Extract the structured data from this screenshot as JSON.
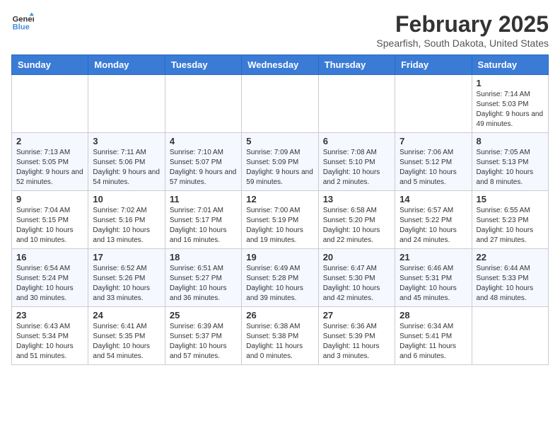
{
  "app": {
    "name": "GeneralBlue",
    "logo_text_part1": "General",
    "logo_text_part2": "Blue"
  },
  "header": {
    "month_year": "February 2025",
    "location": "Spearfish, South Dakota, United States"
  },
  "days_of_week": [
    "Sunday",
    "Monday",
    "Tuesday",
    "Wednesday",
    "Thursday",
    "Friday",
    "Saturday"
  ],
  "weeks": [
    {
      "cells": [
        {
          "day": "",
          "info": ""
        },
        {
          "day": "",
          "info": ""
        },
        {
          "day": "",
          "info": ""
        },
        {
          "day": "",
          "info": ""
        },
        {
          "day": "",
          "info": ""
        },
        {
          "day": "",
          "info": ""
        },
        {
          "day": "1",
          "info": "Sunrise: 7:14 AM\nSunset: 5:03 PM\nDaylight: 9 hours and 49 minutes."
        }
      ]
    },
    {
      "cells": [
        {
          "day": "2",
          "info": "Sunrise: 7:13 AM\nSunset: 5:05 PM\nDaylight: 9 hours and 52 minutes."
        },
        {
          "day": "3",
          "info": "Sunrise: 7:11 AM\nSunset: 5:06 PM\nDaylight: 9 hours and 54 minutes."
        },
        {
          "day": "4",
          "info": "Sunrise: 7:10 AM\nSunset: 5:07 PM\nDaylight: 9 hours and 57 minutes."
        },
        {
          "day": "5",
          "info": "Sunrise: 7:09 AM\nSunset: 5:09 PM\nDaylight: 9 hours and 59 minutes."
        },
        {
          "day": "6",
          "info": "Sunrise: 7:08 AM\nSunset: 5:10 PM\nDaylight: 10 hours and 2 minutes."
        },
        {
          "day": "7",
          "info": "Sunrise: 7:06 AM\nSunset: 5:12 PM\nDaylight: 10 hours and 5 minutes."
        },
        {
          "day": "8",
          "info": "Sunrise: 7:05 AM\nSunset: 5:13 PM\nDaylight: 10 hours and 8 minutes."
        }
      ]
    },
    {
      "cells": [
        {
          "day": "9",
          "info": "Sunrise: 7:04 AM\nSunset: 5:15 PM\nDaylight: 10 hours and 10 minutes."
        },
        {
          "day": "10",
          "info": "Sunrise: 7:02 AM\nSunset: 5:16 PM\nDaylight: 10 hours and 13 minutes."
        },
        {
          "day": "11",
          "info": "Sunrise: 7:01 AM\nSunset: 5:17 PM\nDaylight: 10 hours and 16 minutes."
        },
        {
          "day": "12",
          "info": "Sunrise: 7:00 AM\nSunset: 5:19 PM\nDaylight: 10 hours and 19 minutes."
        },
        {
          "day": "13",
          "info": "Sunrise: 6:58 AM\nSunset: 5:20 PM\nDaylight: 10 hours and 22 minutes."
        },
        {
          "day": "14",
          "info": "Sunrise: 6:57 AM\nSunset: 5:22 PM\nDaylight: 10 hours and 24 minutes."
        },
        {
          "day": "15",
          "info": "Sunrise: 6:55 AM\nSunset: 5:23 PM\nDaylight: 10 hours and 27 minutes."
        }
      ]
    },
    {
      "cells": [
        {
          "day": "16",
          "info": "Sunrise: 6:54 AM\nSunset: 5:24 PM\nDaylight: 10 hours and 30 minutes."
        },
        {
          "day": "17",
          "info": "Sunrise: 6:52 AM\nSunset: 5:26 PM\nDaylight: 10 hours and 33 minutes."
        },
        {
          "day": "18",
          "info": "Sunrise: 6:51 AM\nSunset: 5:27 PM\nDaylight: 10 hours and 36 minutes."
        },
        {
          "day": "19",
          "info": "Sunrise: 6:49 AM\nSunset: 5:28 PM\nDaylight: 10 hours and 39 minutes."
        },
        {
          "day": "20",
          "info": "Sunrise: 6:47 AM\nSunset: 5:30 PM\nDaylight: 10 hours and 42 minutes."
        },
        {
          "day": "21",
          "info": "Sunrise: 6:46 AM\nSunset: 5:31 PM\nDaylight: 10 hours and 45 minutes."
        },
        {
          "day": "22",
          "info": "Sunrise: 6:44 AM\nSunset: 5:33 PM\nDaylight: 10 hours and 48 minutes."
        }
      ]
    },
    {
      "cells": [
        {
          "day": "23",
          "info": "Sunrise: 6:43 AM\nSunset: 5:34 PM\nDaylight: 10 hours and 51 minutes."
        },
        {
          "day": "24",
          "info": "Sunrise: 6:41 AM\nSunset: 5:35 PM\nDaylight: 10 hours and 54 minutes."
        },
        {
          "day": "25",
          "info": "Sunrise: 6:39 AM\nSunset: 5:37 PM\nDaylight: 10 hours and 57 minutes."
        },
        {
          "day": "26",
          "info": "Sunrise: 6:38 AM\nSunset: 5:38 PM\nDaylight: 11 hours and 0 minutes."
        },
        {
          "day": "27",
          "info": "Sunrise: 6:36 AM\nSunset: 5:39 PM\nDaylight: 11 hours and 3 minutes."
        },
        {
          "day": "28",
          "info": "Sunrise: 6:34 AM\nSunset: 5:41 PM\nDaylight: 11 hours and 6 minutes."
        },
        {
          "day": "",
          "info": ""
        }
      ]
    }
  ]
}
